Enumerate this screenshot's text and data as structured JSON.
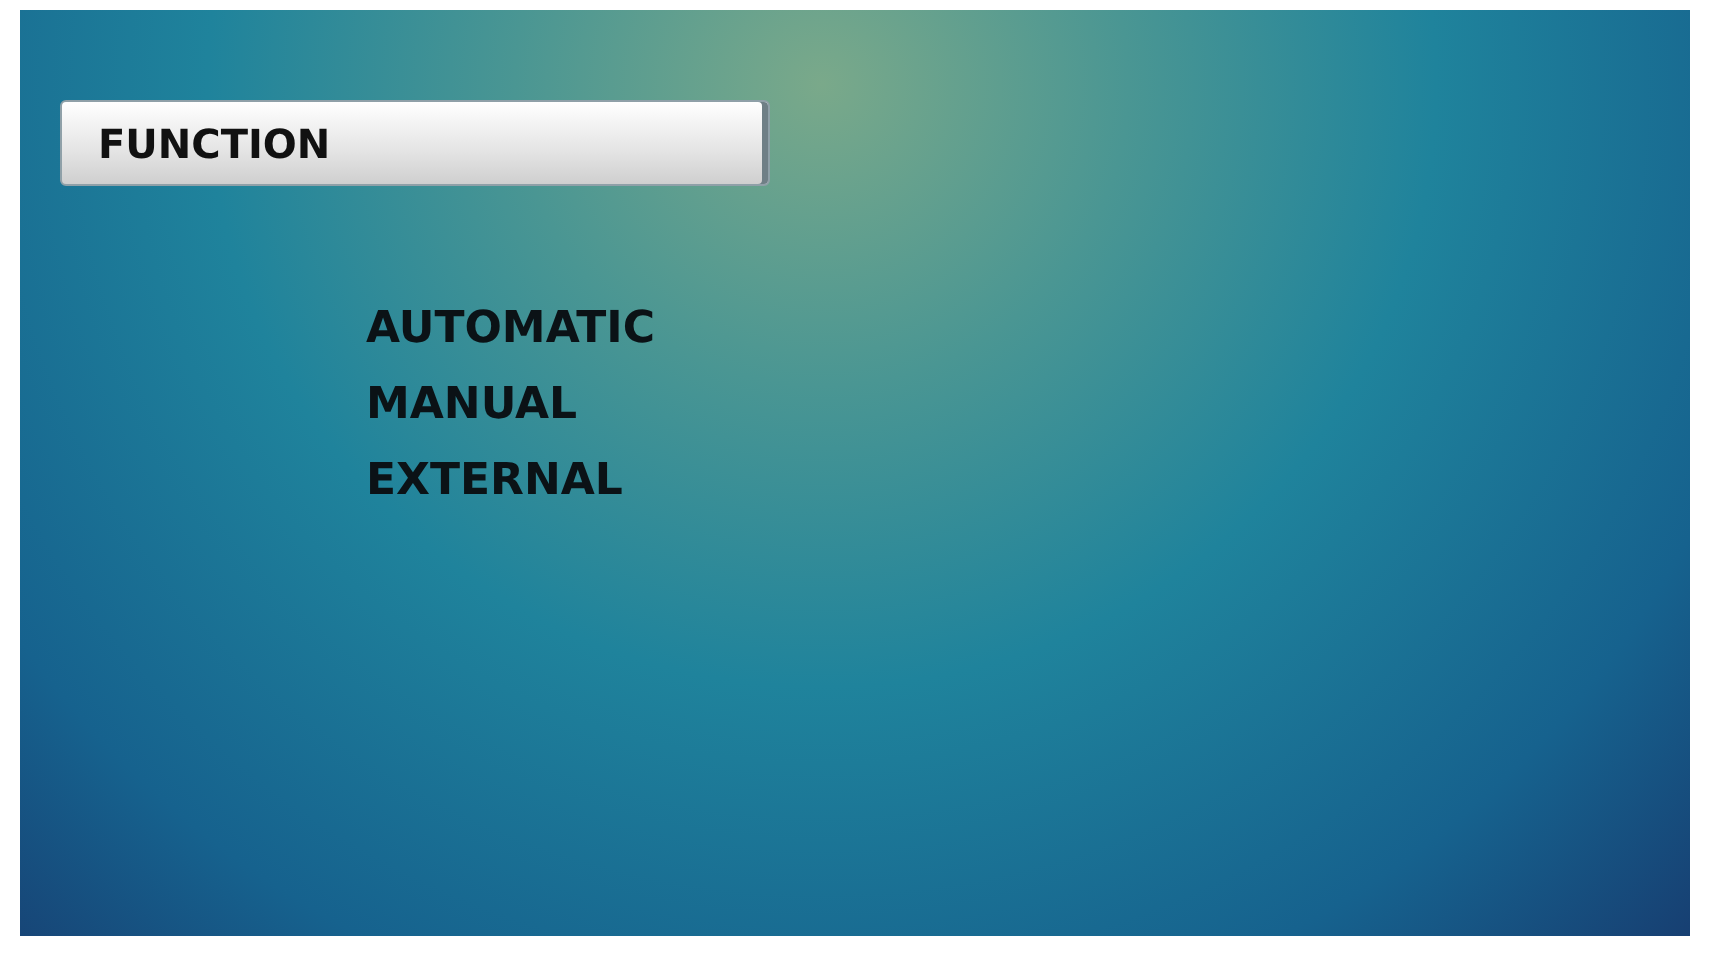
{
  "header": {
    "title": "FUNCTION"
  },
  "options": [
    {
      "label": "AUTOMATIC"
    },
    {
      "label": "MANUAL"
    },
    {
      "label": "EXTERNAL"
    }
  ]
}
